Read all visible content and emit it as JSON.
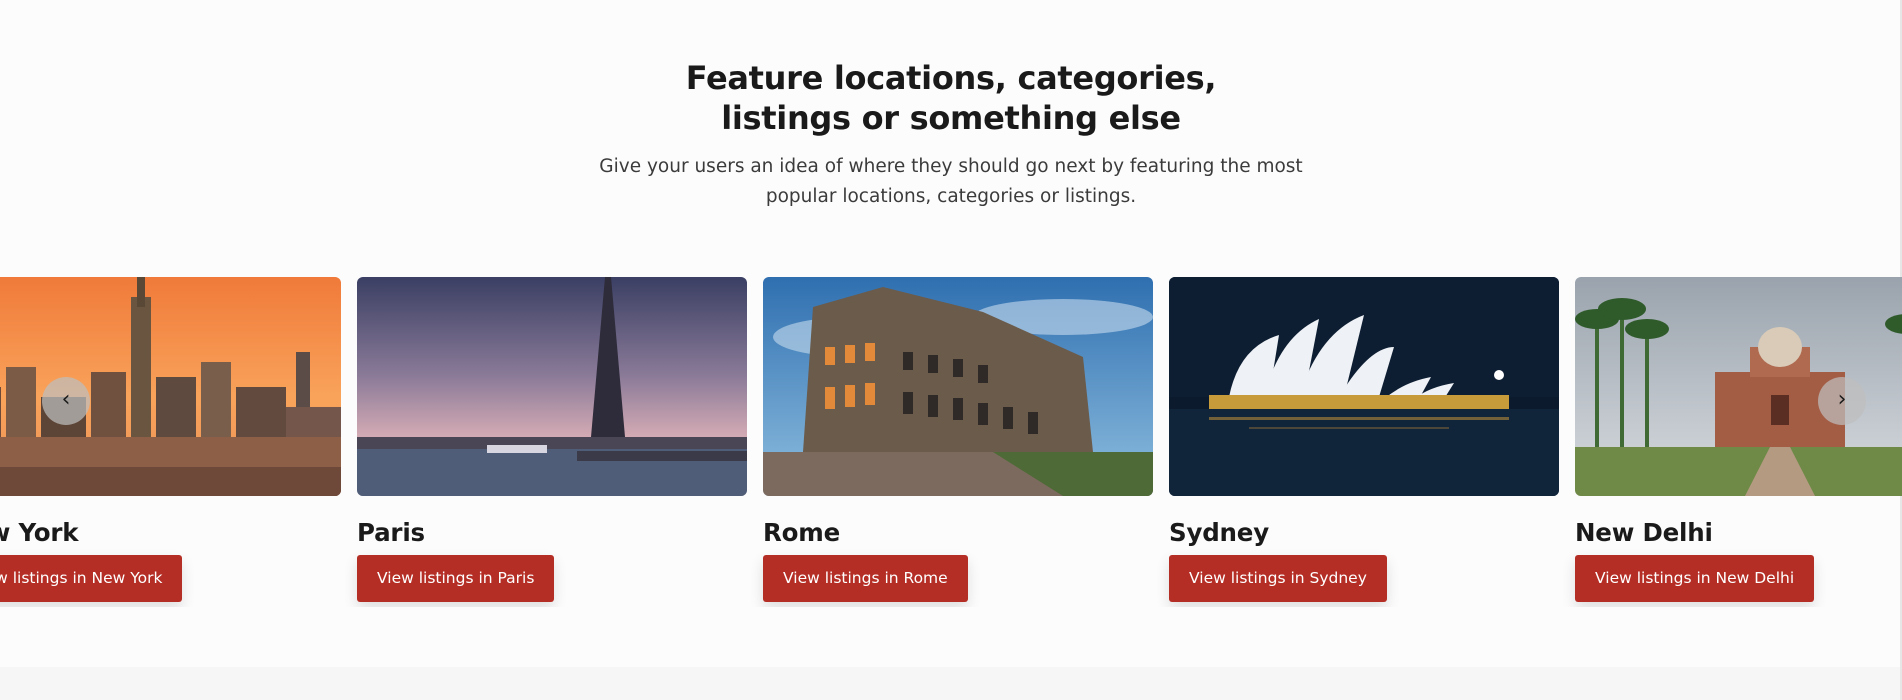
{
  "section": {
    "title": "Feature locations, categories, listings or something else",
    "subtitle": "Give your users an idea of where they should go next by featuring the most popular locations, categories or listings."
  },
  "carousel": {
    "prev_icon": "‹",
    "next_icon": "›",
    "cards": [
      {
        "title": "New York",
        "button": "View listings in New York",
        "image": "new-york-skyline-sunset"
      },
      {
        "title": "Paris",
        "button": "View listings in Paris",
        "image": "paris-eiffel-tower-seine"
      },
      {
        "title": "Rome",
        "button": "View listings in Rome",
        "image": "rome-colosseum-dusk"
      },
      {
        "title": "Sydney",
        "button": "View listings in Sydney",
        "image": "sydney-opera-house-night"
      },
      {
        "title": "New Delhi",
        "button": "View listings in New Delhi",
        "image": "new-delhi-safdarjung-tomb"
      }
    ]
  },
  "colors": {
    "accent": "#b42e25",
    "background": "#fcfcfc",
    "heading": "#1a1a1a"
  }
}
